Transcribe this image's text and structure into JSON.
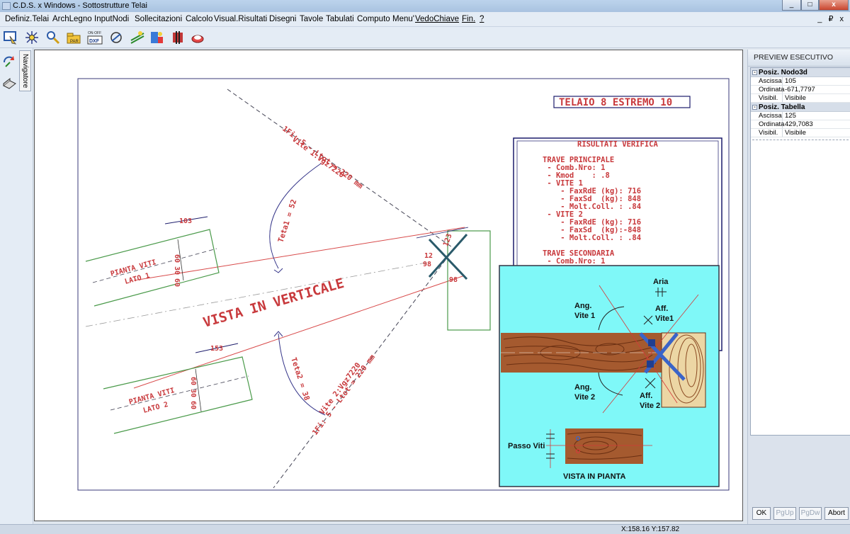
{
  "window": {
    "title": "C.D.S. x Windows - Sottostrutture Telai",
    "minimize": "_",
    "maximize": "□",
    "close": "x"
  },
  "menu": {
    "items": [
      "Definiz.Telai",
      "ArchLegno",
      "InputNodi",
      "Sollecitazioni",
      "Calcolo",
      "Visual.Risultati",
      "Disegni",
      "Tavole",
      "Tabulati",
      "Computo",
      "Menu'",
      "VedoChiave",
      "Fin.",
      "?"
    ],
    "mdi_controls": "_ ₽ x"
  },
  "toolbar": {
    "icons": [
      "select-frame-icon",
      "node-star-icon",
      "zoom-pointer-icon",
      "folder-open-icon",
      "onoff-dxf-icon",
      "dxf-export-icon",
      "section-icon",
      "parallel-lines-icon",
      "results-icon",
      "paint-icon",
      "eraser-icon"
    ]
  },
  "navigator": {
    "tab_label": "Navigatore"
  },
  "drawing": {
    "title": "TELAIO 8 ESTREMO 10",
    "main_label": "VISTA IN VERTICALE",
    "results_title": "RISULTATI VERIFICA",
    "results_lines": [
      "TRAVE PRINCIPALE",
      " - Comb.Nro: 1",
      " - Kmod    : .8",
      " - VITE 1",
      "    - FaxRdE (kg): 716",
      "    - FaxSd  (kg): 848",
      "    - Molt.Coll. : .84",
      " - VITE 2",
      "    - FaxRdE (kg): 716",
      "    - FaxSd  (kg):-848",
      "    - Molt.Coll. : .84",
      "",
      "TRAVE SECONDARIA",
      " - Comb.Nro: 1"
    ],
    "angle1_label": "Teta1 = 52",
    "angle2_label": "Teta2 = 38",
    "screw1_label_a": "1Fi: 5 - Ltot = 220 mm",
    "screw1_label_b": "Vite 1:Vgz7220",
    "screw2_label_a": "1Fi: 5 - Ltot = 220 mm",
    "screw2_label_b": "Vite 2:Vgz7220",
    "plan1_label_a": "PIANTA VITI",
    "plan1_label_b": "LATO 1",
    "plan2_label_a": "PIANTA VITI",
    "plan2_label_b": "LATO 2",
    "dim_103": "103",
    "dim_153": "153",
    "dim_60a": "60",
    "dim_30a": "30",
    "dim_60b": "60",
    "dim_60c": "60",
    "dim_30b": "30",
    "dim_60d": "60",
    "dim_123": "123",
    "dim_12": "12",
    "dim_98a": "98",
    "dim_98b": "98"
  },
  "preview": {
    "labels": {
      "aria": "Aria",
      "ang_vite1": "Ang.",
      "ang_vite1_b": "Vite 1",
      "aff_vite1": "Aff.",
      "aff_vite1_b": "Vite1",
      "ang_vite2": "Ang.",
      "ang_vite2_b": "Vite 2",
      "aff_vite2": "Aff.",
      "aff_vite2_b": "Vite 2",
      "passo_viti": "Passo Viti",
      "vista_pianta": "VISTA IN PIANTA"
    },
    "colors": {
      "bg": "#7ff8f8",
      "wood": "#a55a2f",
      "wood_light": "#ecd6a4",
      "screw": "#3a64c8"
    }
  },
  "right_panel": {
    "title": "PREVIEW ESECUTIVO",
    "groups": [
      {
        "name": "Posiz. Nodo3d",
        "rows": [
          {
            "key": "Ascissa",
            "value": "105"
          },
          {
            "key": "Ordinata",
            "value": "-671,7797"
          },
          {
            "key": "Visibil.",
            "value": "Visibile"
          }
        ]
      },
      {
        "name": "Posiz. Tabella",
        "rows": [
          {
            "key": "Ascissa",
            "value": "125"
          },
          {
            "key": "Ordinata",
            "value": "429,7083"
          },
          {
            "key": "Visibil.",
            "value": "Visibile"
          }
        ]
      }
    ],
    "buttons": {
      "ok": "OK",
      "pgup": "PgUp",
      "pgdw": "PgDw",
      "abort": "Abort"
    }
  },
  "status": {
    "coords": "X:158.16  Y:157.82"
  }
}
